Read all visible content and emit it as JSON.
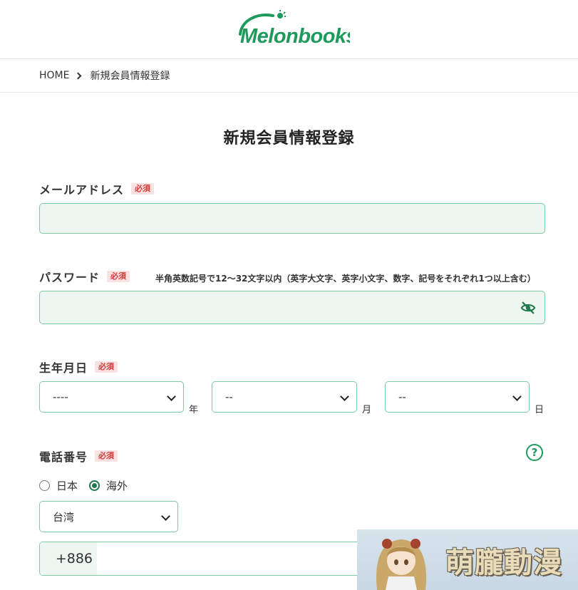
{
  "header": {
    "logo_text": "Melonbooks"
  },
  "breadcrumb": {
    "home": "HOME",
    "current": "新規会員情報登録"
  },
  "page": {
    "title": "新規会員情報登録"
  },
  "form": {
    "required_badge": "必須",
    "email": {
      "label": "メールアドレス",
      "value": ""
    },
    "password": {
      "label": "パスワード",
      "hint": "半角英数記号で12～32文字以内（英字大文字、英字小文字、数字、記号をそれぞれ1つ以上含む）",
      "value": "",
      "toggle_icon": "eye-slash-icon"
    },
    "birthdate": {
      "label": "生年月日",
      "year": {
        "value": "----",
        "unit": "年"
      },
      "month": {
        "value": "--",
        "unit": "月"
      },
      "day": {
        "value": "--",
        "unit": "日"
      }
    },
    "phone": {
      "label": "電話番号",
      "help_icon": "question-circle-icon",
      "help_text": "?",
      "options": [
        {
          "label": "日本",
          "checked": false
        },
        {
          "label": "海外",
          "checked": true
        }
      ],
      "country": "台湾",
      "prefix": "+886",
      "value": ""
    }
  },
  "watermark": {
    "text": "萌朧動漫"
  },
  "colors": {
    "accent": "#1e9a5c",
    "input_bg": "#eef6f1",
    "input_border": "#7fcaa5",
    "required_bg": "#fbe1e1",
    "required_fg": "#d43b3b"
  }
}
